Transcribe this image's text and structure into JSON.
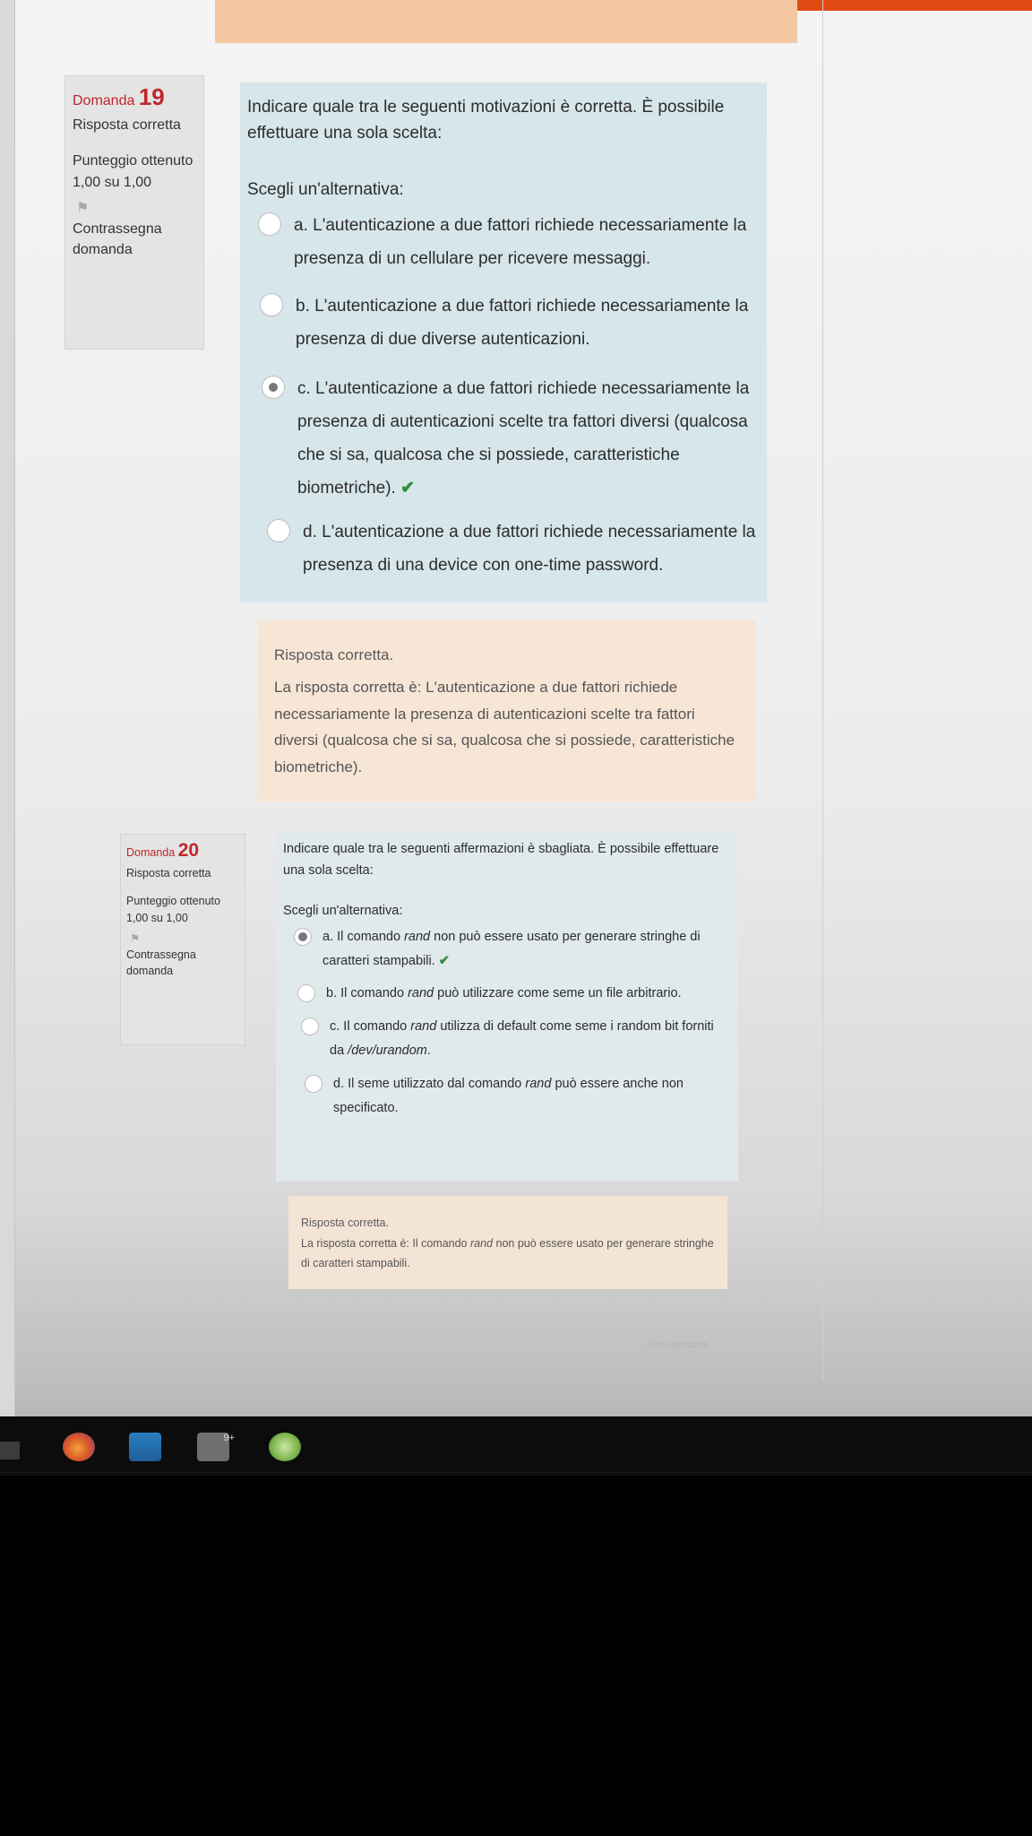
{
  "q19": {
    "label": "Domanda",
    "number": "19",
    "status": "Risposta corretta",
    "score": "Punteggio ottenuto 1,00 su 1,00",
    "flag_label": "Contrassegna domanda",
    "prompt": "Indicare quale tra le seguenti motivazioni è corretta. È possibile effettuare una sola scelta:",
    "choose": "Scegli un'alternativa:",
    "options": [
      "a. L'autenticazione a due fattori richiede necessariamente la presenza di un cellulare per ricevere messaggi.",
      "b. L'autenticazione a due fattori richiede necessariamente la presenza di due diverse autenticazioni.",
      "c. L'autenticazione a due fattori richiede necessariamente la presenza di autenticazioni scelte tra fattori diversi (qualcosa che si sa, qualcosa che si possiede, caratteristiche biometriche).",
      "d. L'autenticazione a due fattori richiede necessariamente la presenza di una device con one-time password."
    ],
    "selected_index": 2,
    "feedback_title": "Risposta corretta.",
    "feedback_text": "La risposta corretta è: L'autenticazione a due fattori richiede necessariamente la presenza di autenticazioni scelte tra fattori diversi (qualcosa che si sa, qualcosa che si possiede, caratteristiche biometriche)."
  },
  "q20": {
    "label": "Domanda",
    "number": "20",
    "status": "Risposta corretta",
    "score": "Punteggio ottenuto 1,00 su 1,00",
    "flag_label": "Contrassegna domanda",
    "prompt": "Indicare quale tra le seguenti affermazioni è sbagliata. È possibile effettuare una sola scelta:",
    "choose": "Scegli un'alternativa:",
    "options": {
      "a_pre": "a. Il comando ",
      "a_em": "rand",
      "a_post": " non può essere usato per generare stringhe di caratteri stampabili.",
      "b_pre": "b. Il comando ",
      "b_em": "rand",
      "b_post": " può utilizzare come seme un file arbitrario.",
      "c_pre": "c. Il comando ",
      "c_em": "rand",
      "c_mid": " utilizza di default come seme i random bit forniti da ",
      "c_em2": "/dev/urandom",
      "c_post": ".",
      "d_pre": "d. Il seme utilizzato dal comando ",
      "d_em": "rand",
      "d_post": " può essere anche non specificato."
    },
    "selected_index": 0,
    "feedback_title": "Risposta corretta.",
    "feedback_pre": "La risposta corretta è: Il comando ",
    "feedback_em": "rand",
    "feedback_post": " non può essere usato per generare stringhe di caratteri stampabili."
  },
  "footer": {
    "finish_link": "Fine revisione"
  },
  "taskbar": {
    "icons": [
      "firefox-icon",
      "mail-icon",
      "chat-icon",
      "app-icon"
    ],
    "badge": "9+"
  },
  "colors": {
    "accent_red": "#c0262b",
    "question_bg": "#d7e6ea",
    "feedback_bg": "#f7e6d6",
    "check_green": "#2f8a3a"
  }
}
